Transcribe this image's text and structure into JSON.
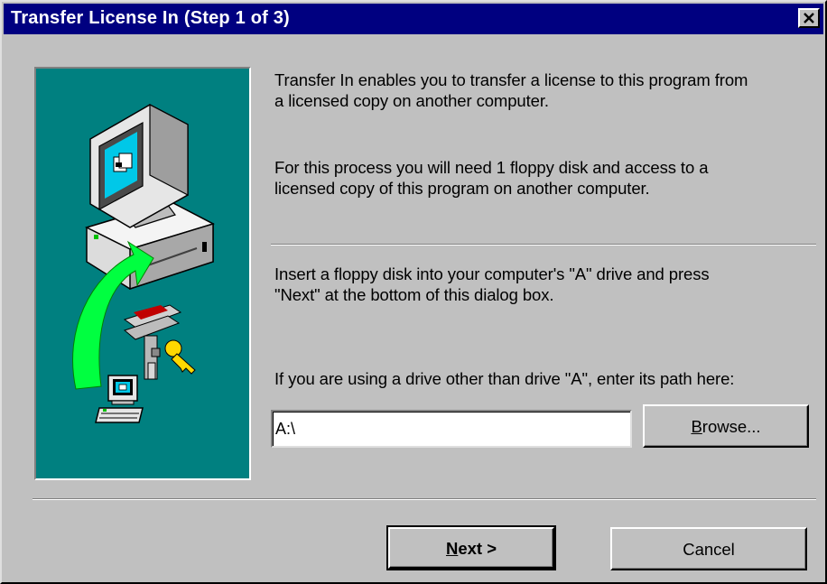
{
  "window": {
    "title": "Transfer License In (Step 1 of 3)",
    "close_label": "×",
    "close_icon": "close-x-icon"
  },
  "illustration": {
    "background_color": "#008080",
    "icons": [
      "computer-monitor-icon",
      "transfer-arrow-icon",
      "floppy-disk-key-icon",
      "small-computer-icon"
    ]
  },
  "content": {
    "para1_line1": "Transfer In enables you to transfer a license to this program from",
    "para1_line2": "a licensed copy on another computer.",
    "para2_line1": "For this process you will need 1 floppy disk and access to a",
    "para2_line2": "licensed copy of this program on another computer.",
    "para3_line1": "Insert a floppy disk into your computer's \"A\" drive and press",
    "para3_line2": "\"Next\" at the bottom of this dialog box.",
    "para4": "If you are using a drive other than drive \"A\", enter its path here:"
  },
  "path_field": {
    "value": "A:\\"
  },
  "buttons": {
    "browse_mnemonic": "B",
    "browse_rest": "rowse...",
    "next_mnemonic": "N",
    "next_rest": "ext >",
    "cancel": "Cancel"
  },
  "colors": {
    "titlebar": "#000080",
    "face": "#c0c0c0",
    "arrow": "#00ff40"
  }
}
